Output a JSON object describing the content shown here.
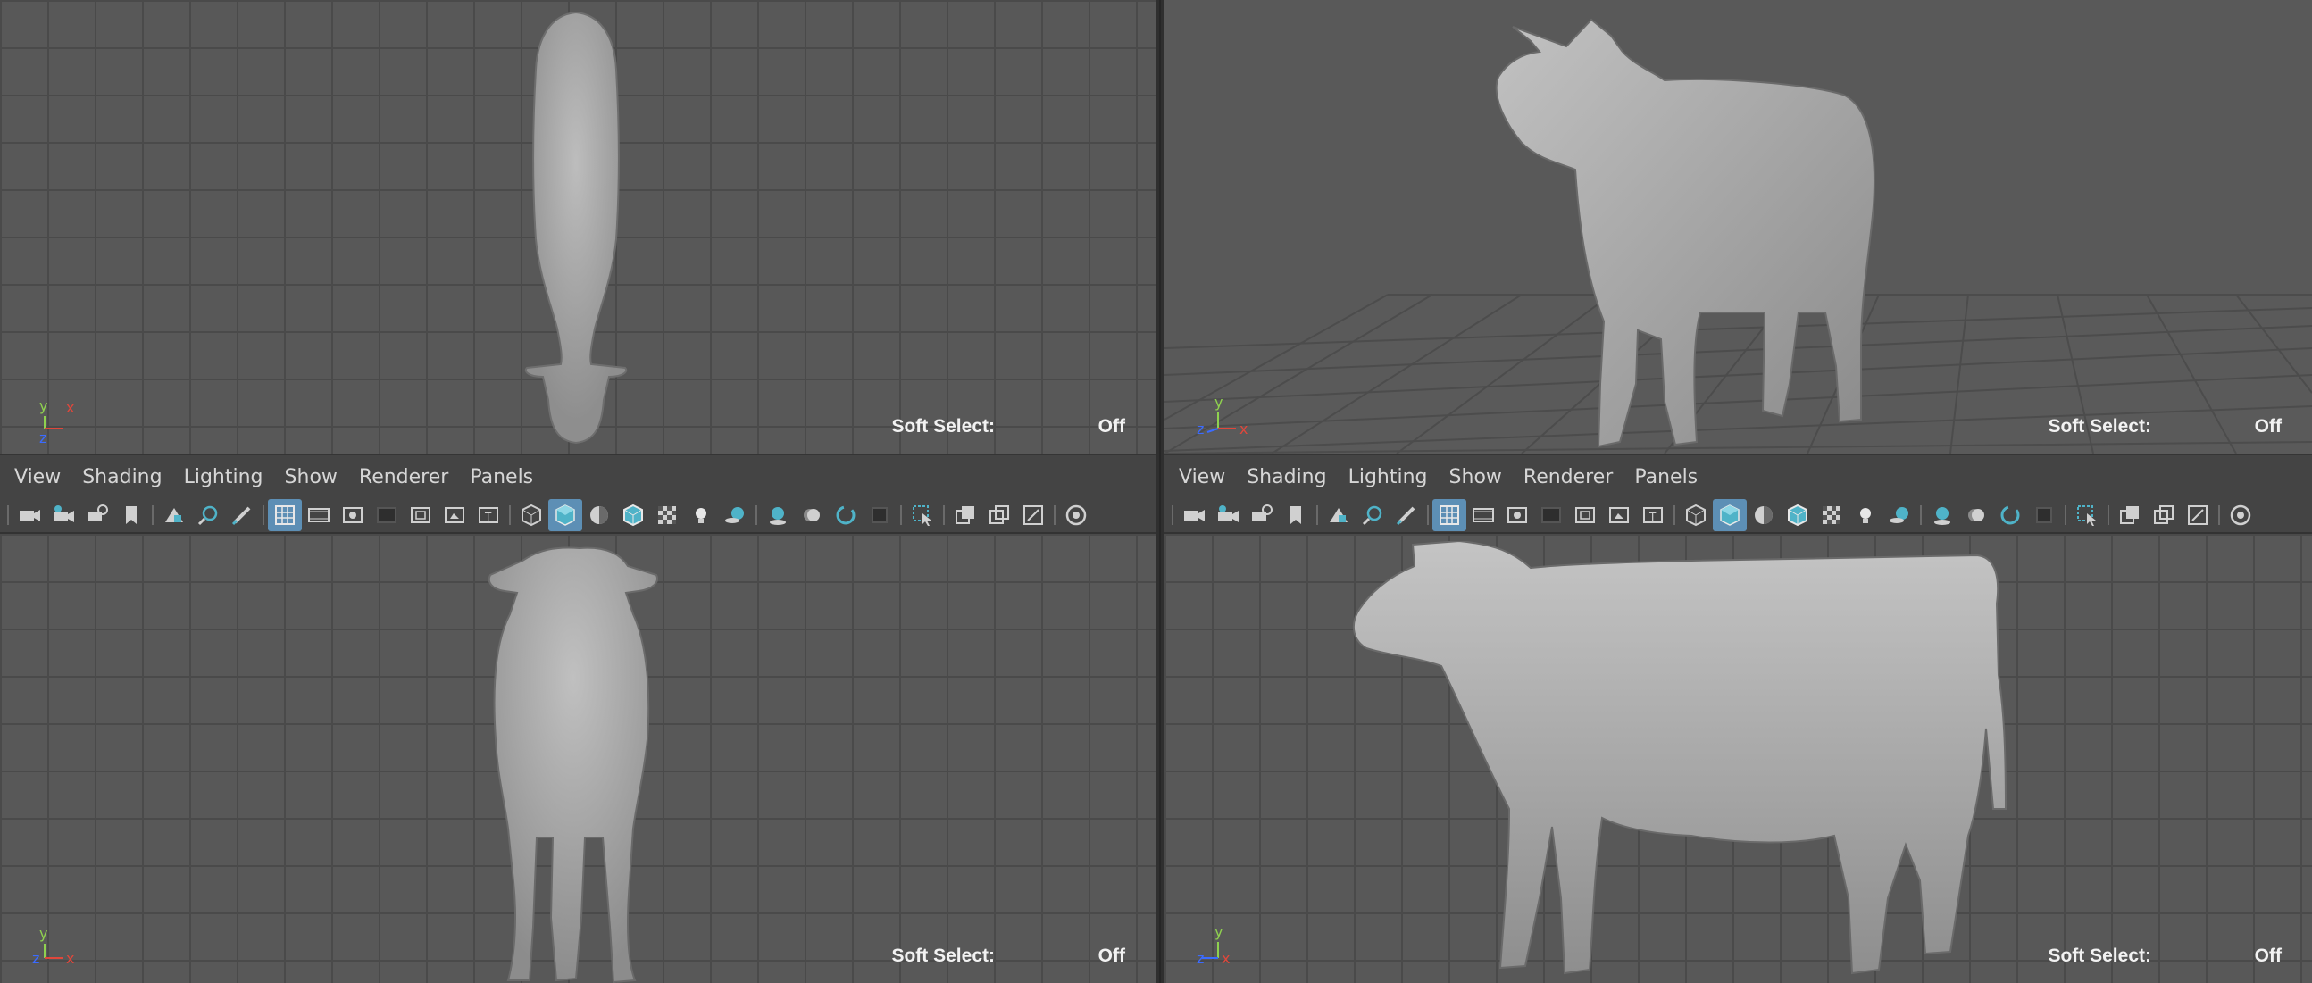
{
  "panels": {
    "top": {
      "soft_select_label": "Soft Select:",
      "soft_select_value": "Off",
      "axis": {
        "y": "y",
        "x": "x",
        "z": "z"
      }
    },
    "persp": {
      "soft_select_label": "Soft Select:",
      "soft_select_value": "Off",
      "axis": {
        "y": "y",
        "x": "x",
        "z": "z"
      }
    },
    "front": {
      "soft_select_label": "Soft Select:",
      "soft_select_value": "Off",
      "axis": {
        "y": "y",
        "x": "x",
        "z": "z"
      }
    },
    "side": {
      "soft_select_label": "Soft Select:",
      "soft_select_value": "Off",
      "axis": {
        "y": "y",
        "x": "x",
        "z": "z"
      }
    }
  },
  "menubar": [
    "View",
    "Shading",
    "Lighting",
    "Show",
    "Renderer",
    "Panels"
  ],
  "toolbar_icons": [
    "select-camera-icon",
    "camera-attributes-icon",
    "lock-camera-icon",
    "bookmark-icon",
    "image-plane-icon",
    "2d-pan-zoom-icon",
    "grease-pencil-icon",
    "grid-icon",
    "film-gate-icon",
    "resolution-gate-icon",
    "gate-mask-icon",
    "field-chart-icon",
    "safe-action-icon",
    "safe-title-icon",
    "wireframe-icon",
    "smooth-shade-icon",
    "default-material-icon",
    "wireframe-on-shaded-icon",
    "textured-icon",
    "use-all-lights-icon",
    "shadows-icon",
    "screen-space-ao-icon",
    "motion-blur-icon",
    "anti-aliasing-icon",
    "depth-of-field-icon",
    "isolate-select-icon",
    "xray-icon",
    "xray-joints-icon",
    "xray-active-icon",
    "exposure-icon"
  ],
  "colors": {
    "viewport_bg": "#585858",
    "grid_line": "#4a4a4a",
    "toolbar_bg": "#444444",
    "active_button": "#5d8fb5",
    "axis_y": "#8fd14f",
    "axis_x": "#e0473b",
    "axis_z": "#3b6bff",
    "cow_fill": "#a9a9a9"
  }
}
